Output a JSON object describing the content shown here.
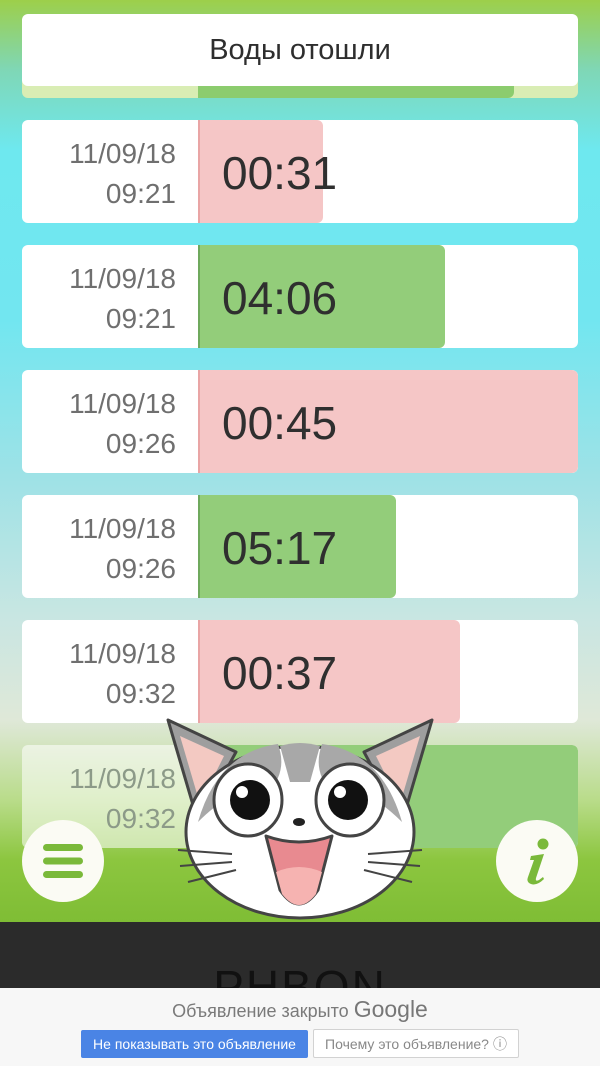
{
  "header": {
    "water_broke_label": "Воды отошли"
  },
  "contractions": [
    {
      "date": "11/09/18",
      "time": "09:21",
      "duration": "00:31",
      "type": "contraction",
      "level": 0.33
    },
    {
      "date": "11/09/18",
      "time": "09:21",
      "duration": "04:06",
      "type": "interval",
      "level": 0.65
    },
    {
      "date": "11/09/18",
      "time": "09:26",
      "duration": "00:45",
      "type": "contraction",
      "level": 1.0
    },
    {
      "date": "11/09/18",
      "time": "09:26",
      "duration": "05:17",
      "type": "interval",
      "level": 0.52
    },
    {
      "date": "11/09/18",
      "time": "09:32",
      "duration": "00:37",
      "type": "contraction",
      "level": 0.69
    },
    {
      "date": "11/09/18",
      "time": "09:32",
      "duration": "",
      "type": "interval",
      "level": 1.0
    }
  ],
  "colors": {
    "contraction": "#f5c6c6",
    "interval": "#93cd7a",
    "ad_button": "#4a84e5"
  },
  "icons": {
    "menu": "hamburger-menu-icon",
    "info": "info-icon",
    "mascot": "cat-mascot"
  },
  "ad": {
    "background_text": "PHBON",
    "closed_text": "Объявление закрыто",
    "brand": "Google",
    "hide_button": "Не показывать это объявление",
    "why_button": "Почему это объявление?",
    "why_icon": "ⓘ"
  }
}
